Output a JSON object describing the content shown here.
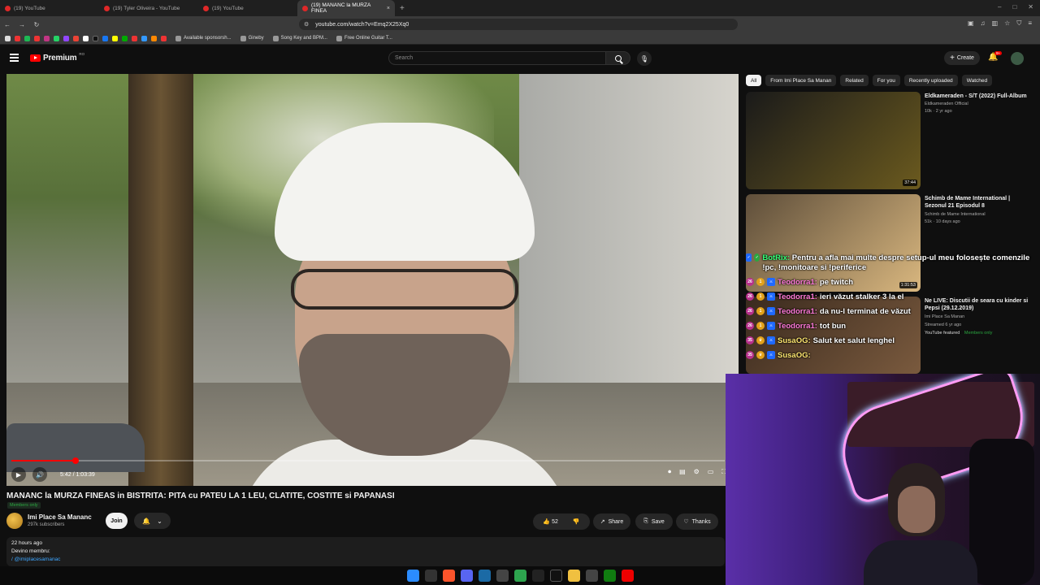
{
  "browser": {
    "tabs": [
      {
        "label": "(19) YouTube",
        "active": false
      },
      {
        "label": "(19) Tyler Oliveira - YouTube",
        "active": false
      },
      {
        "label": "(19) YouTube",
        "active": false
      },
      {
        "label": "(19) MANANC la MURZA FINEA",
        "active": true
      }
    ],
    "url": "youtube.com/watch?v=Emq2X25Xq0",
    "bookmarks": [
      "Available sponsorsh...",
      "Gineby",
      "Song Key and BPM...",
      "Free Online Guitar T..."
    ]
  },
  "header": {
    "logo_text": "Premium",
    "country_code": "RO",
    "search_placeholder": "Search",
    "create_label": "Create",
    "notif_count": "9+"
  },
  "player": {
    "current_time": "5:42",
    "duration": "1:03:39",
    "time_display": "5:42 / 1:03:39",
    "progress_fraction": 0.09
  },
  "video": {
    "title": "MANANC la MURZA FINEAS in BISTRITA: PITA cu PATEU LA 1 LEU, CLATITE, COSTITE si PAPANASI",
    "members_tag": "Members only",
    "channel_name": "Imi Place Sa Mananc",
    "subscribers": "297k subscribers",
    "join_label": "Join",
    "likes": "52",
    "share_label": "Share",
    "save_label": "Save",
    "thanks_label": "Thanks",
    "description": {
      "age": "22 hours ago",
      "line2": "Devino membru:",
      "link": "/ @imiplacesamanac"
    }
  },
  "chips": [
    "All",
    "From Imi Place Sa Manan",
    "Related",
    "For you",
    "Recently uploaded",
    "Watched"
  ],
  "recommendations": [
    {
      "title": "Eldkameraden - S/T (2022) Full-Album",
      "channel": "Eldkameraden Official",
      "meta": "10k · 2 yr ago",
      "duration": "37:44",
      "colors": [
        "#1a1a1a",
        "#6b5a1e"
      ]
    },
    {
      "title": "Schimb de Mame International | Sezonul 21 Episodul 8",
      "channel": "Schimb de Mame International",
      "meta": "51k · 10 days ago",
      "duration": "1:31:53",
      "colors": [
        "#5e4e3a",
        "#d9b77f"
      ]
    },
    {
      "title": "Ne LIVE: Discutii de seara cu kinder si Pepsi (29.12.2019)",
      "channel": "Imi Place Sa Manan",
      "meta": "Streamed 6 yr ago",
      "featured": "YouTube featured",
      "members": "Members only",
      "duration": "",
      "colors": [
        "#3a2a1e",
        "#7a5a3e"
      ]
    }
  ],
  "chat": [
    {
      "user": "BotRix:",
      "message": "Pentru a afla mai multe despre setup-ul meu folosește comenzile !pc, !monitoare si !periferice",
      "type": "bot"
    },
    {
      "user": "Teodorra1:",
      "message": "pe twitch",
      "type": "user"
    },
    {
      "user": "Teodorra1:",
      "message": "ieri văzut stalker 3 la el",
      "type": "user"
    },
    {
      "user": "Teodorra1:",
      "message": "da nu-l terminat de văzut",
      "type": "user"
    },
    {
      "user": "Teodorra1:",
      "message": "tot bun",
      "type": "user"
    },
    {
      "user": "SusaOG:",
      "message": "Salut ket salut lenghel",
      "type": "susa"
    },
    {
      "user": "SusaOG:",
      "message": "",
      "type": "susa"
    }
  ]
}
